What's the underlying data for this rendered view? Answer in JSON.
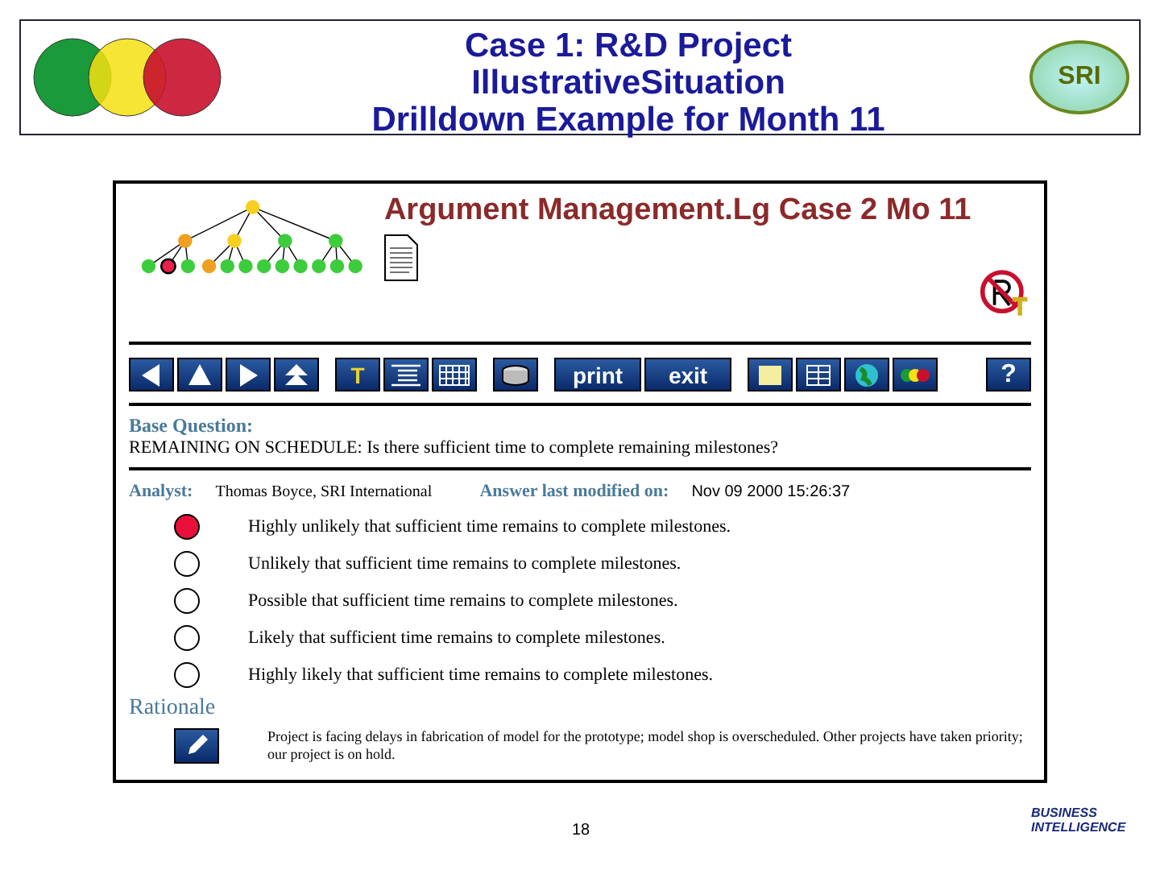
{
  "header": {
    "title_lines": [
      "Case 1: R&D Project",
      "IllustrativeSituation",
      "Drilldown Example for Month 11"
    ],
    "logo_text": "SRI"
  },
  "panel": {
    "title": "Argument Management.Lg Case 2 Mo 11",
    "toolbar_groups": [
      [
        {
          "kind": "left"
        },
        {
          "kind": "up"
        },
        {
          "kind": "right"
        },
        {
          "kind": "top"
        }
      ],
      [
        {
          "kind": "letter",
          "label": "T"
        },
        {
          "kind": "outline"
        },
        {
          "kind": "grid"
        }
      ],
      [
        {
          "kind": "drum"
        }
      ],
      [
        {
          "kind": "wide",
          "label": "print"
        },
        {
          "kind": "wide",
          "label": "exit"
        }
      ],
      [
        {
          "kind": "note"
        },
        {
          "kind": "columns"
        },
        {
          "kind": "globe"
        },
        {
          "kind": "lights"
        }
      ],
      [
        {
          "kind": "help",
          "label": "?"
        }
      ]
    ],
    "base_question": {
      "label": "Base Question:",
      "text": "REMAINING ON SCHEDULE: Is there sufficient time to complete remaining milestones?"
    },
    "analyst": {
      "label": "Analyst:",
      "value": "Thomas Boyce, SRI International"
    },
    "modified": {
      "label": "Answer last modified on:",
      "value": "Nov 09 2000 15:26:37"
    },
    "choices": [
      {
        "text": "Highly unlikely that sufficient time remains to complete milestones.",
        "selected": true
      },
      {
        "text": "Unlikely that sufficient time remains to complete milestones.",
        "selected": false
      },
      {
        "text": "Possible that sufficient time remains to complete milestones.",
        "selected": false
      },
      {
        "text": "Likely that sufficient time remains to complete milestones.",
        "selected": false
      },
      {
        "text": "Highly likely that sufficient time remains to complete milestones.",
        "selected": false
      }
    ],
    "rationale": {
      "label": "Rationale",
      "text": "Project is facing delays in fabrication of model for the prototype; model shop is overscheduled. Other projects have taken priority; our project is on hold."
    }
  },
  "footer": {
    "page_number": "18",
    "logo_text": "BUSINESS INTELLIGENCE"
  }
}
